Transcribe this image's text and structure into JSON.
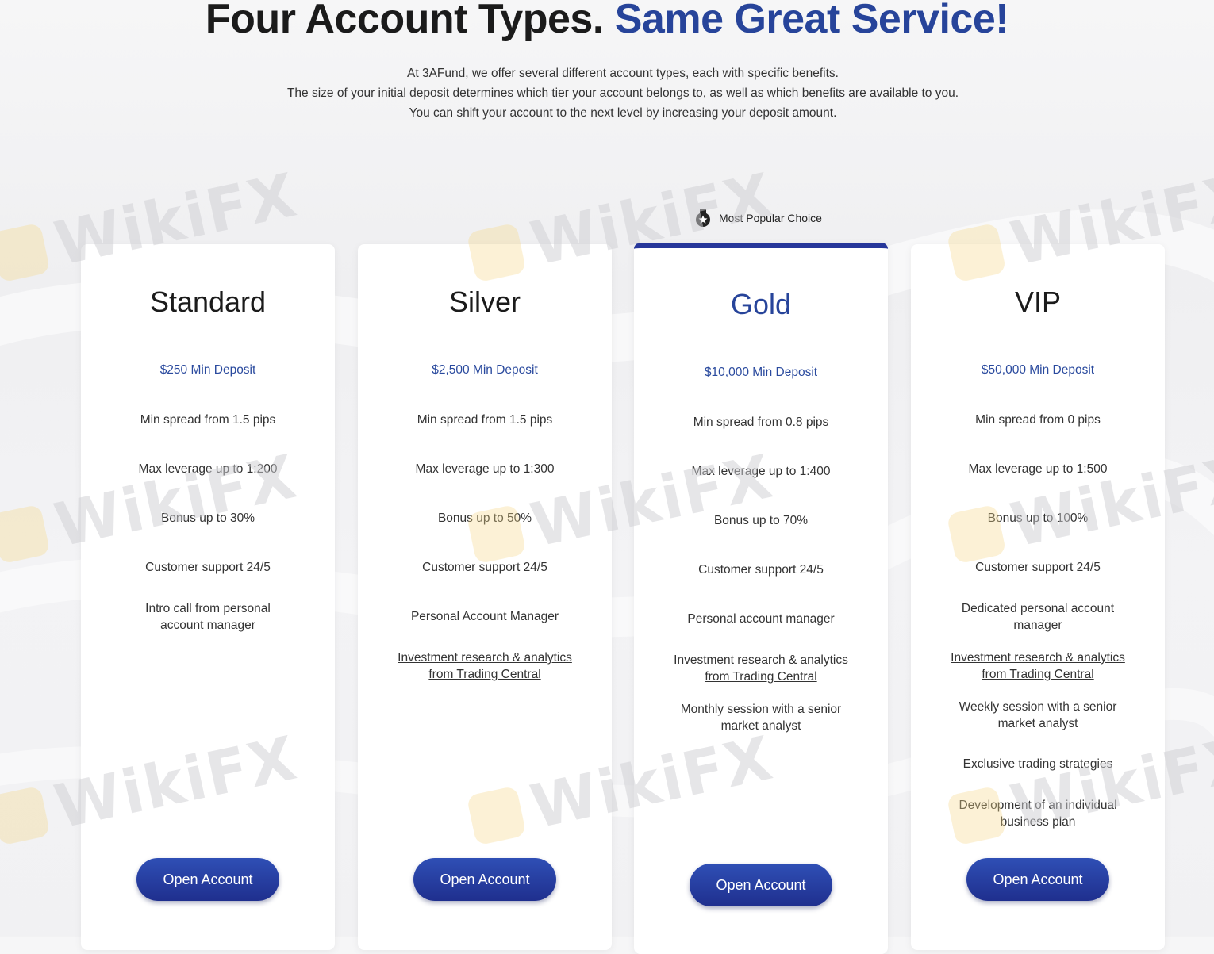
{
  "heading": {
    "main": "Four Account Types.",
    "accent": "Same Great Service!",
    "accent_color": "#27449a"
  },
  "intro": {
    "line1": "At 3AFund, we offer several different account types, each with specific benefits.",
    "line2": "The size of your initial deposit determines which tier your account belongs to, as well as which benefits are available to you.",
    "line3": "You can shift your account to the next level by increasing your deposit amount."
  },
  "popular_badge": {
    "label": "Most Popular Choice",
    "icon": "medal-icon"
  },
  "watermark": "WikiFX",
  "cards": [
    {
      "title": "Standard",
      "deposit": "$250 Min Deposit",
      "features": [
        "Min spread from 1.5 pips",
        "Max leverage up to 1:200",
        "Bonus up to 30%",
        "Customer support 24/5",
        "Intro call from personal account manager"
      ],
      "button": "Open Account"
    },
    {
      "title": "Silver",
      "deposit": "$2,500 Min Deposit",
      "features": [
        "Min spread from 1.5 pips",
        "Max leverage up to 1:300",
        "Bonus up to 50%",
        "Customer support 24/5",
        "Personal Account Manager",
        "Investment research & analytics from Trading Central"
      ],
      "button": "Open Account"
    },
    {
      "title": "Gold",
      "deposit": "$10,000 Min Deposit",
      "features": [
        "Min spread from 0.8 pips",
        "Max leverage up to 1:400",
        "Bonus up to 70%",
        "Customer support 24/5",
        "Personal account manager",
        "Investment research & analytics from Trading Central",
        "Monthly session with a senior market analyst"
      ],
      "button": "Open Account"
    },
    {
      "title": "VIP",
      "deposit": "$50,000 Min Deposit",
      "features": [
        "Min spread from 0 pips",
        "Max leverage up to 1:500",
        "Bonus up to 100%",
        "Customer support 24/5",
        "Dedicated personal account manager",
        "Investment research & analytics from Trading Central",
        "Weekly session with a senior market analyst",
        "Exclusive trading strategies",
        "Development of an individual business plan"
      ],
      "button": "Open Account"
    }
  ],
  "colors": {
    "brand_blue": "#27449a",
    "button_gradient_top": "#2f4fb5",
    "button_gradient_bottom": "#1f2f8e",
    "gold_top_bar": "#27379a"
  }
}
